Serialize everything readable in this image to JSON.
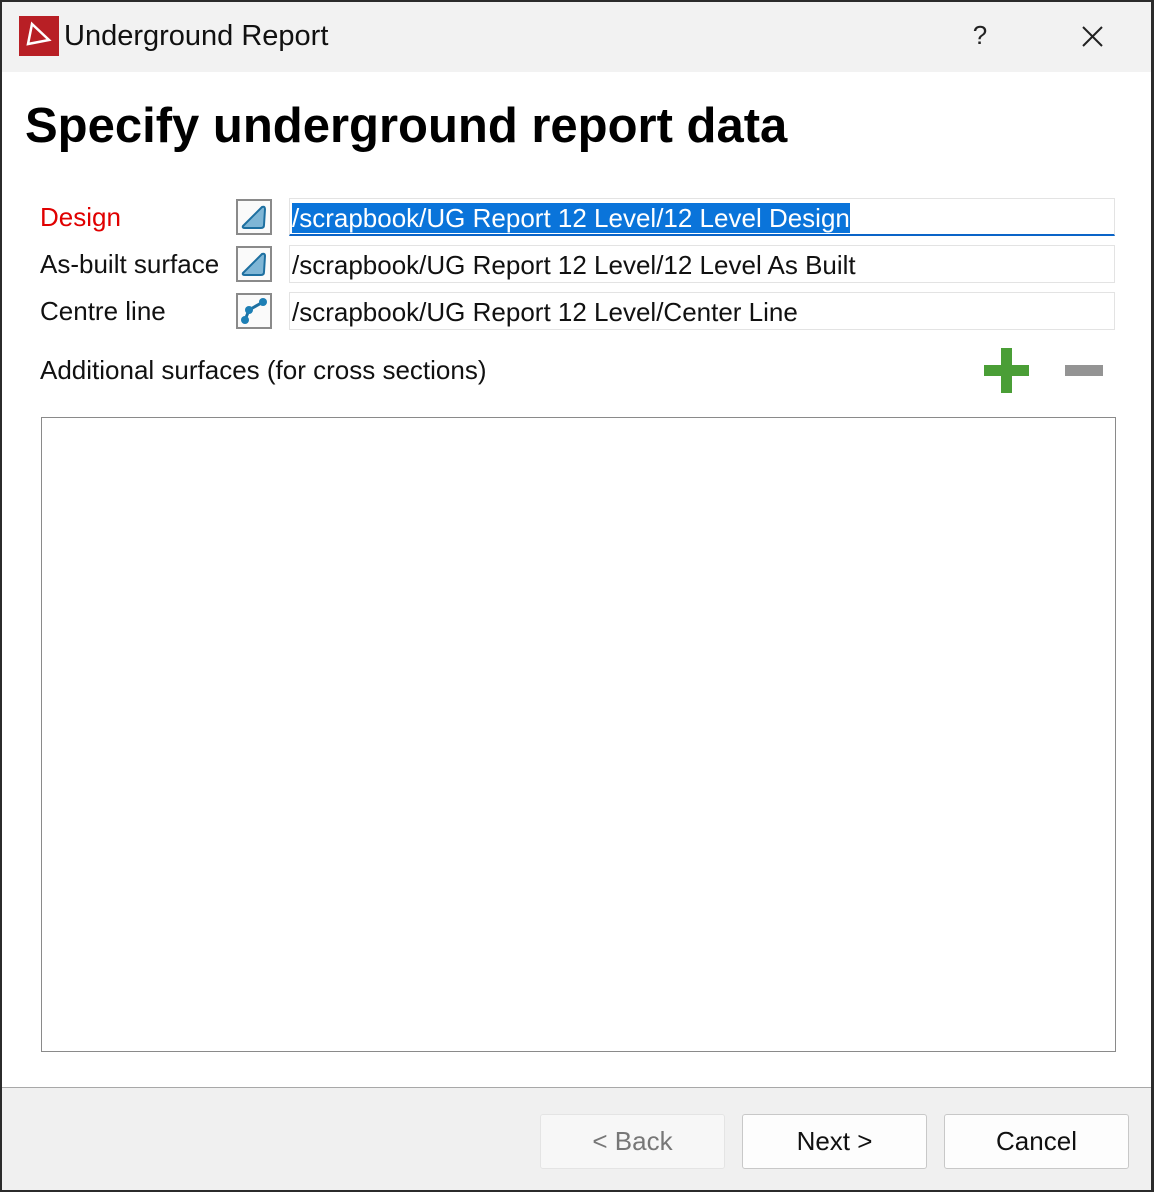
{
  "window": {
    "title": "Underground Report",
    "help_label": "?"
  },
  "heading": "Specify underground report data",
  "fields": [
    {
      "label": "Design",
      "value": "/scrapbook/UG Report 12 Level/12 Level Design",
      "icon": "surface-icon",
      "required": true
    },
    {
      "label": "As-built surface",
      "value": "/scrapbook/UG Report 12 Level/12 Level As Built",
      "icon": "surface-icon"
    },
    {
      "label": "Centre line",
      "value": "/scrapbook/UG Report 12 Level/Center Line",
      "icon": "polyline-icon"
    }
  ],
  "additional": {
    "label": "Additional surfaces (for cross sections)",
    "items": []
  },
  "buttons": {
    "back": "< Back",
    "next": "Next >",
    "cancel": "Cancel"
  },
  "colors": {
    "required": "#e00000",
    "add": "#4a9e36",
    "remove": "#949494",
    "selection": "#0a74da",
    "brand": "#b81f25"
  }
}
